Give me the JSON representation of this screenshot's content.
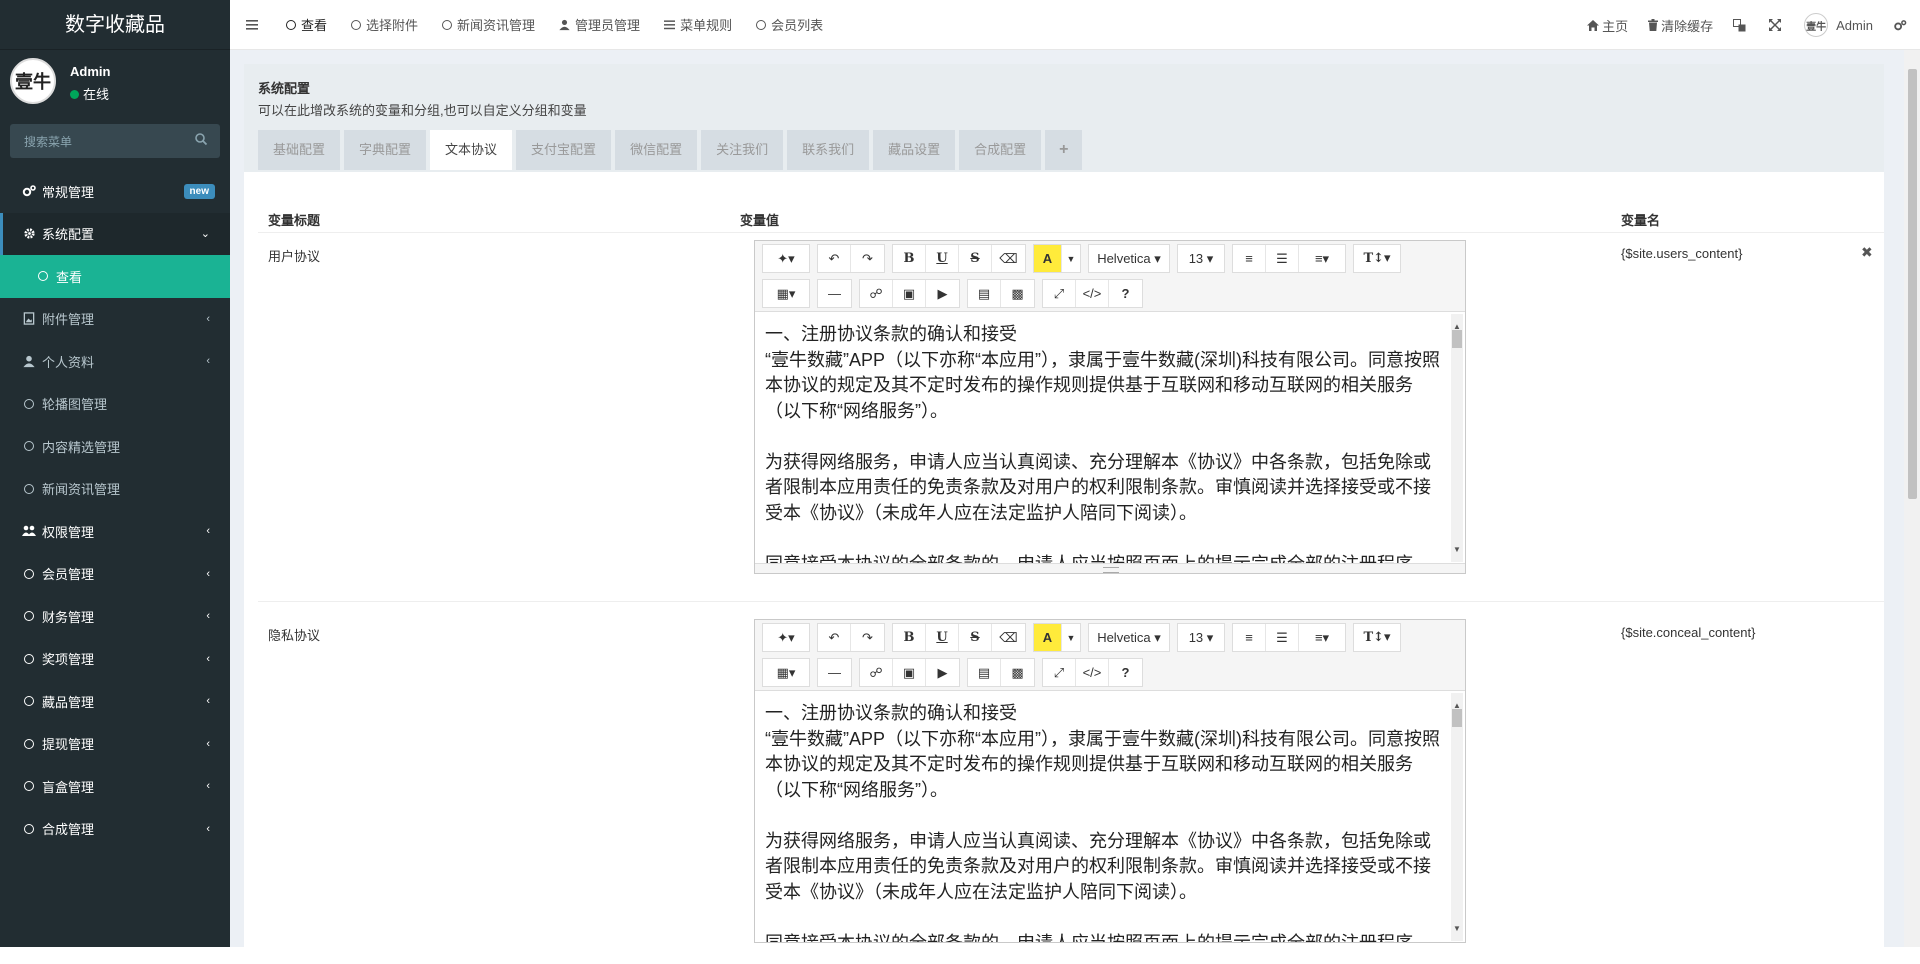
{
  "app": {
    "brand": "数字收藏品"
  },
  "user": {
    "name": "Admin",
    "status": "在线",
    "avatar_text": "壹牛"
  },
  "search": {
    "placeholder": "搜索菜单"
  },
  "sidebar": {
    "items": [
      {
        "label": "常规管理",
        "badge": "new"
      },
      {
        "label": "系统配置"
      },
      {
        "label": "查看"
      },
      {
        "label": "附件管理"
      },
      {
        "label": "个人资料"
      },
      {
        "label": "轮播图管理"
      },
      {
        "label": "内容精选管理"
      },
      {
        "label": "新闻资讯管理"
      },
      {
        "label": "权限管理"
      },
      {
        "label": "会员管理"
      },
      {
        "label": "财务管理"
      },
      {
        "label": "奖项管理"
      },
      {
        "label": "藏品管理"
      },
      {
        "label": "提现管理"
      },
      {
        "label": "盲盒管理"
      },
      {
        "label": "合成管理"
      }
    ]
  },
  "topbar": {
    "tabs": [
      "查看",
      "选择附件",
      "新闻资讯管理",
      "管理员管理",
      "菜单规则",
      "会员列表"
    ],
    "home": "主页",
    "clear_cache": "清除缓存",
    "user": "Admin"
  },
  "panel": {
    "title": "系统配置",
    "desc": "可以在此增改系统的变量和分组,也可以自定义分组和变量",
    "tabs": [
      "基础配置",
      "字典配置",
      "文本协议",
      "支付宝配置",
      "微信配置",
      "关注我们",
      "联系我们",
      "藏品设置",
      "合成配置"
    ],
    "add": "+"
  },
  "table": {
    "col_title": "变量标题",
    "col_value": "变量值",
    "col_name": "变量名"
  },
  "rows": [
    {
      "label": "用户协议",
      "var": "{$site.users_content}"
    },
    {
      "label": "隐私协议",
      "var": "{$site.conceal_content}"
    }
  ],
  "editor": {
    "font": "Helvetica",
    "size": "13",
    "content": {
      "p1": "一、注册协议条款的确认和接受",
      "p2": "“壹牛数藏”APP（以下亦称“本应用”），隶属于壹牛数藏(深圳)科技有限公司。同意按照本协议的规定及其不定时发布的操作规则提供基于互联网和移动互联网的相关服务（以下称“网络服务”）。",
      "p3": "为获得网络服务，申请人应当认真阅读、充分理解本《协议》中各条款，包括免除或者限制本应用责任的免责条款及对用户的权利限制条款。审慎阅读并选择接受或不接受本《协议》（未成年人应在法定监护人陪同下阅读）。",
      "p4": "同意接受本协议的全部条款的，申请人应当按照页面上的提示完成全部的注册程序。"
    }
  },
  "colors": {
    "sidebar": "#222d32",
    "active_sub": "#1ab394",
    "badge": "#3c8dbc",
    "online": "#00a65a"
  }
}
